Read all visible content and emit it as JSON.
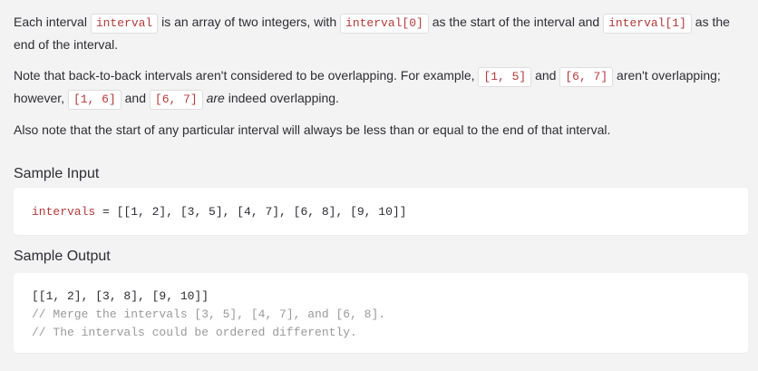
{
  "paragraph1": {
    "t1": "Each interval ",
    "c1": "interval",
    "t2": " is an array of two integers, with ",
    "c2": "interval[0]",
    "t3": " as the start of the interval and ",
    "c3": "interval[1]",
    "t4": " as the end of the interval."
  },
  "paragraph2": {
    "t1": "Note that back-to-back intervals aren't considered to be overlapping. For example, ",
    "c1": "[1, 5]",
    "t2": " and ",
    "c2": "[6, 7]",
    "t3": " aren't overlapping; however, ",
    "c3": "[1, 6]",
    "t4": " and ",
    "c4": "[6, 7]",
    "t5": " ",
    "em": "are",
    "t6": " indeed overlapping."
  },
  "paragraph3": {
    "text": "Also note that the start of any particular interval will always be less than or equal to the end of that interval."
  },
  "sample_input": {
    "title": "Sample Input",
    "var_name": "intervals",
    "operator": " = ",
    "value": "[[1, 2], [3, 5], [4, 7], [6, 8], [9, 10]]"
  },
  "sample_output": {
    "title": "Sample Output",
    "line1": "[[1, 2], [3, 8], [9, 10]]",
    "comment1": "// Merge the intervals [3, 5], [4, 7], and [6, 8].",
    "comment2": "// The intervals could be ordered differently."
  }
}
